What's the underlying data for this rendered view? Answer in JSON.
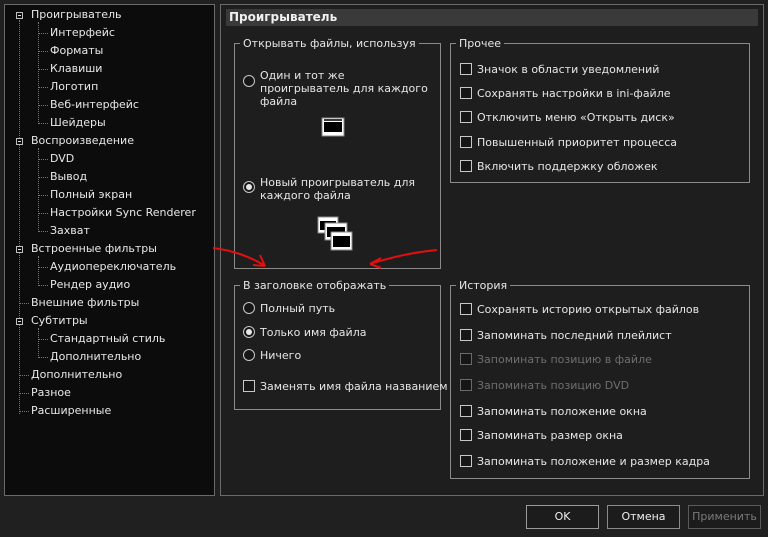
{
  "tree": {
    "items": [
      {
        "label": "Проигрыватель",
        "level": 0,
        "toggle": true
      },
      {
        "label": "Интерфейс",
        "level": 1
      },
      {
        "label": "Форматы",
        "level": 1
      },
      {
        "label": "Клавиши",
        "level": 1
      },
      {
        "label": "Логотип",
        "level": 1
      },
      {
        "label": "Веб-интерфейс",
        "level": 1
      },
      {
        "label": "Шейдеры",
        "level": 1
      },
      {
        "label": "Воспроизведение",
        "level": 0,
        "toggle": true
      },
      {
        "label": "DVD",
        "level": 1
      },
      {
        "label": "Вывод",
        "level": 1
      },
      {
        "label": "Полный экран",
        "level": 1
      },
      {
        "label": "Настройки Sync Renderer",
        "level": 1
      },
      {
        "label": "Захват",
        "level": 1
      },
      {
        "label": "Встроенные фильтры",
        "level": 0,
        "toggle": true
      },
      {
        "label": "Аудиопереключатель",
        "level": 1
      },
      {
        "label": "Рендер аудио",
        "level": 1
      },
      {
        "label": "Внешние фильтры",
        "level": 0
      },
      {
        "label": "Субтитры",
        "level": 0,
        "toggle": true
      },
      {
        "label": "Стандартный стиль",
        "level": 1
      },
      {
        "label": "Дополнительно",
        "level": 1
      },
      {
        "label": "Дополнительно",
        "level": 0
      },
      {
        "label": "Разное",
        "level": 0
      },
      {
        "label": "Расширенные",
        "level": 0
      }
    ]
  },
  "main": {
    "title": "Проигрыватель",
    "open_files": {
      "legend": "Открывать файлы, используя",
      "opt_same": "Один и тот же проигрыватель для каждого файла",
      "opt_new": "Новый проигрыватель для каждого файла"
    },
    "other": {
      "legend": "Прочее",
      "items": [
        {
          "label": "Значок в области уведомлений",
          "checked": false,
          "disabled": false
        },
        {
          "label": "Сохранять настройки в ini-файле",
          "checked": false,
          "disabled": false
        },
        {
          "label": "Отключить меню «Открыть диск»",
          "checked": false,
          "disabled": false
        },
        {
          "label": "Повышенный приоритет процесса",
          "checked": false,
          "disabled": false
        },
        {
          "label": "Включить поддержку обложек",
          "checked": false,
          "disabled": false
        }
      ]
    },
    "title_show": {
      "legend": "В заголовке отображать",
      "radios": [
        "Полный путь",
        "Только имя файла",
        "Ничего"
      ],
      "selected": 1,
      "replace_label": "Заменять имя файла названием"
    },
    "history": {
      "legend": "История",
      "items": [
        {
          "label": "Сохранять историю открытых файлов",
          "disabled": false
        },
        {
          "label": "Запоминать последний плейлист",
          "disabled": false
        },
        {
          "label": "Запоминать позицию в файле",
          "disabled": true
        },
        {
          "label": "Запоминать позицию DVD",
          "disabled": true
        },
        {
          "label": "Запоминать положение окна",
          "disabled": false
        },
        {
          "label": "Запоминать размер окна",
          "disabled": false
        },
        {
          "label": "Запоминать положение и размер кадра",
          "disabled": false
        }
      ]
    }
  },
  "buttons": {
    "ok": "OK",
    "cancel": "Отмена",
    "apply": "Применить"
  },
  "colors": {
    "background": "#202020",
    "panel": "#0c0c0c",
    "annotation_arrow": "#e01010"
  },
  "icons": [
    "minus-toggle-icon",
    "single-window-icon",
    "multi-window-icon",
    "red-arrow-annotation"
  ]
}
